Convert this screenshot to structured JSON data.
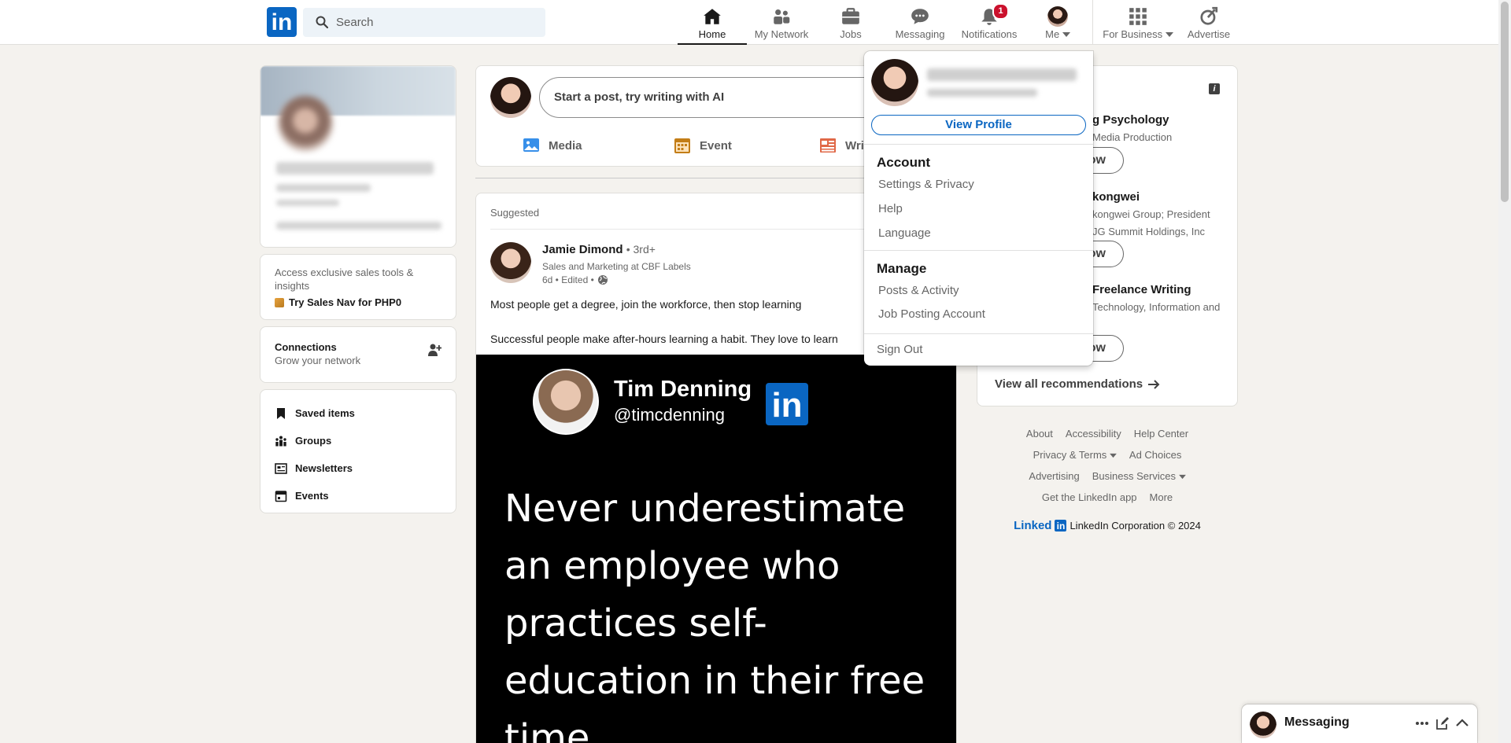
{
  "nav": {
    "logo_text": "in",
    "search_placeholder": "Search",
    "items": [
      {
        "label": "Home",
        "icon": "home-icon"
      },
      {
        "label": "My Network",
        "icon": "network-icon"
      },
      {
        "label": "Jobs",
        "icon": "briefcase-icon"
      },
      {
        "label": "Messaging",
        "icon": "chat-icon"
      },
      {
        "label": "Notifications",
        "icon": "bell-icon",
        "badge": "1"
      },
      {
        "label": "Me",
        "icon": "avatar"
      },
      {
        "label": "For Business",
        "icon": "grid-icon"
      },
      {
        "label": "Advertise",
        "icon": "compass-icon"
      }
    ]
  },
  "left": {
    "salesnav_sub": "Access exclusive sales tools & insights",
    "salesnav_cta": "Try Sales Nav for PHP0",
    "connections_title": "Connections",
    "connections_sub": "Grow your network",
    "links": [
      "Saved items",
      "Groups",
      "Newsletters",
      "Events"
    ]
  },
  "share": {
    "placeholder": "Start a post, try writing with AI",
    "actions": [
      "Media",
      "Event",
      "Wri"
    ]
  },
  "post": {
    "suggested": "Suggested",
    "author_name": "Jamie Dimond",
    "author_degree": "• 3rd+",
    "author_headline": "Sales and Marketing at CBF Labels",
    "author_time": "6d • Edited •",
    "text1": "Most people get a degree, join the workforce, then stop learning",
    "text2": "Successful people make after-hours learning a habit. They love to learn",
    "image_name": "Tim Denning",
    "image_handle": "@timcdenning",
    "image_quote": "Never underestimate an employee who practices self-education in their free time."
  },
  "right": {
    "recs": [
      {
        "title": "g Psychology",
        "sub": "Media Production",
        "btn": "ow"
      },
      {
        "title": "kongwei",
        "sub": "kongwei Group; President",
        "sub2": "JG Summit Holdings, Inc",
        "btn": "ow"
      },
      {
        "title": "Freelance Writing",
        "sub": "Technology, Information and",
        "btn": "ow"
      }
    ],
    "view_all": "View all recommendations",
    "footer_rows": [
      [
        "About",
        "Accessibility",
        "Help Center"
      ],
      [
        "Privacy & Terms",
        "Ad Choices"
      ],
      [
        "Advertising",
        "Business Services"
      ],
      [
        "Get the LinkedIn app",
        "More"
      ]
    ],
    "copyright_word": "Linked",
    "copyright_mini": "in",
    "copyright": "LinkedIn Corporation © 2024"
  },
  "dropdown": {
    "view_profile": "View Profile",
    "account_head": "Account",
    "account_items": [
      "Settings & Privacy",
      "Help",
      "Language"
    ],
    "manage_head": "Manage",
    "manage_items": [
      "Posts & Activity",
      "Job Posting Account"
    ],
    "sign_out": "Sign Out"
  },
  "messaging": {
    "label": "Messaging"
  },
  "colors": {
    "brand": "#0a66c2",
    "badge": "#cb112d",
    "background": "#f4f2ee"
  }
}
